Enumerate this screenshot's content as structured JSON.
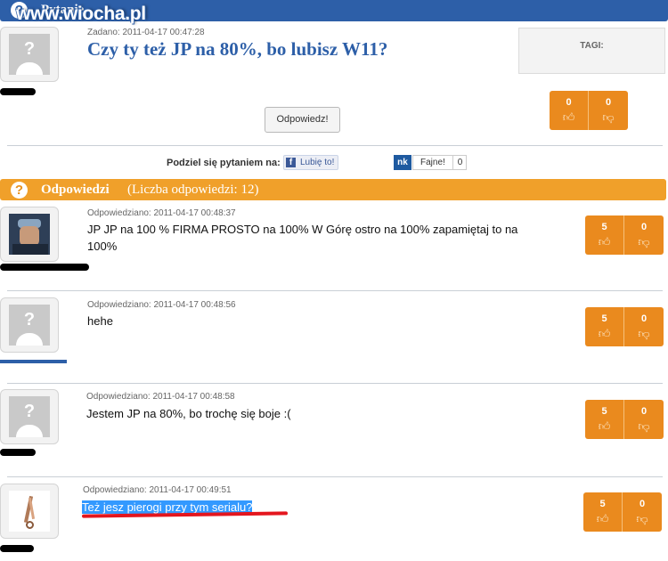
{
  "watermark": "www.wiocha.pl",
  "question_bar": {
    "icon": "?",
    "title": "Pytanie"
  },
  "question": {
    "meta": "Zadano: 2011-04-17 00:47:28",
    "title": "Czy ty też JP na 80%, bo lubisz W11?",
    "tags_label": "TAGI:",
    "votes": {
      "up": "0",
      "down": "0"
    },
    "answer_button": "Odpowiedz!"
  },
  "share": {
    "label": "Podziel się pytaniem na:",
    "facebook_label": "Lubię to!",
    "facebook_icon": "f",
    "nk_icon": "nk",
    "nk_label": "Fajne!",
    "nk_count": "0"
  },
  "answers_bar": {
    "icon": "?",
    "title": "Odpowiedzi",
    "count_text": "(Liczba odpowiedzi: 12)"
  },
  "answers": [
    {
      "meta": "Odpowiedziano: 2011-04-17 00:48:37",
      "text": "JP JP na 100 % FIRMA PROSTO na 100% W Górę ostro na 100% zapamiętaj to na 100%",
      "up": "5",
      "down": "0"
    },
    {
      "meta": "Odpowiedziano: 2011-04-17 00:48:56",
      "text": "hehe",
      "up": "5",
      "down": "0"
    },
    {
      "meta": "Odpowiedziano: 2011-04-17 00:48:58",
      "text": "Jestem JP na 80%, bo trochę się boje :(",
      "up": "5",
      "down": "0"
    },
    {
      "meta": "Odpowiedziano: 2011-04-17 00:49:51",
      "text": "Też jesz pierogi przy tym serialu?",
      "up": "5",
      "down": "0"
    }
  ],
  "colors": {
    "question_bar": "#2d5fa8",
    "answers_bar": "#f0a02a",
    "vote_button": "#ea8a1e",
    "highlight": "#3399ff",
    "red_underline": "#e4161e"
  },
  "icons": {
    "thumb_up": "thumbs-up-icon",
    "thumb_down": "thumbs-down-icon",
    "default_avatar": "default-avatar-icon"
  }
}
